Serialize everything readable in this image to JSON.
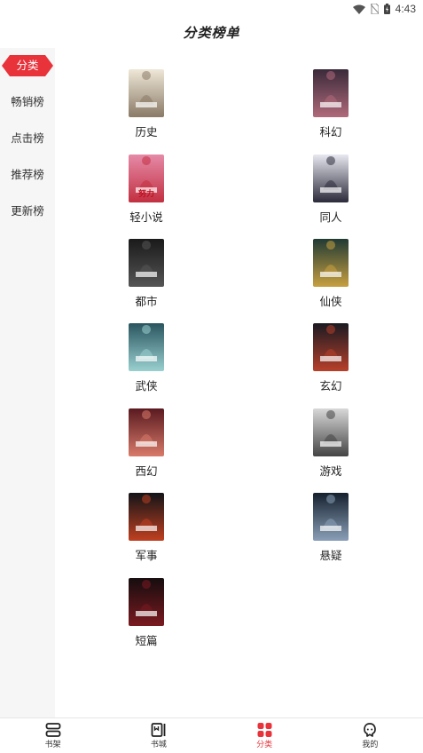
{
  "status_bar": {
    "time": "4:43"
  },
  "header": {
    "title": "分类榜单"
  },
  "sidebar": {
    "items": [
      {
        "label": "分类",
        "active": true
      },
      {
        "label": "畅销榜",
        "active": false
      },
      {
        "label": "点击榜",
        "active": false
      },
      {
        "label": "推荐榜",
        "active": false
      },
      {
        "label": "更新榜",
        "active": false
      }
    ]
  },
  "categories": [
    {
      "label": "历史",
      "cover_text": "",
      "cover_colors": [
        "#efe7d8",
        "#8a7a66"
      ]
    },
    {
      "label": "科幻",
      "cover_text": "",
      "cover_colors": [
        "#3a2a3a",
        "#b06a7a"
      ]
    },
    {
      "label": "轻小说",
      "cover_text": "努力",
      "cover_colors": [
        "#e58aa8",
        "#c23040"
      ]
    },
    {
      "label": "同人",
      "cover_text": "",
      "cover_colors": [
        "#e8e8f0",
        "#2a2a3a"
      ]
    },
    {
      "label": "都市",
      "cover_text": "",
      "cover_colors": [
        "#1a1a1a",
        "#555555"
      ]
    },
    {
      "label": "仙侠",
      "cover_text": "",
      "cover_colors": [
        "#203a34",
        "#c8a040"
      ]
    },
    {
      "label": "武侠",
      "cover_text": "",
      "cover_colors": [
        "#2a5560",
        "#9ad0d0"
      ]
    },
    {
      "label": "玄幻",
      "cover_text": "",
      "cover_colors": [
        "#1a1a22",
        "#b8402a"
      ]
    },
    {
      "label": "西幻",
      "cover_text": "",
      "cover_colors": [
        "#5a1a20",
        "#d87a6a"
      ]
    },
    {
      "label": "游戏",
      "cover_text": "",
      "cover_colors": [
        "#d8d8d8",
        "#444444"
      ]
    },
    {
      "label": "军事",
      "cover_text": "",
      "cover_colors": [
        "#121418",
        "#c04020"
      ]
    },
    {
      "label": "悬疑",
      "cover_text": "",
      "cover_colors": [
        "#15202e",
        "#8aa0b8"
      ]
    },
    {
      "label": "短篇",
      "cover_text": "",
      "cover_colors": [
        "#160d0f",
        "#7a1a20"
      ]
    }
  ],
  "bottom_nav": [
    {
      "label": "书架",
      "icon": "bookshelf-icon",
      "active": false
    },
    {
      "label": "书城",
      "icon": "bookstore-icon",
      "active": false
    },
    {
      "label": "分类",
      "icon": "category-icon",
      "active": true
    },
    {
      "label": "我的",
      "icon": "profile-icon",
      "active": false
    }
  ],
  "colors": {
    "accent": "#e8333b",
    "sidebar_bg": "#f6f6f6",
    "text": "#222222"
  }
}
